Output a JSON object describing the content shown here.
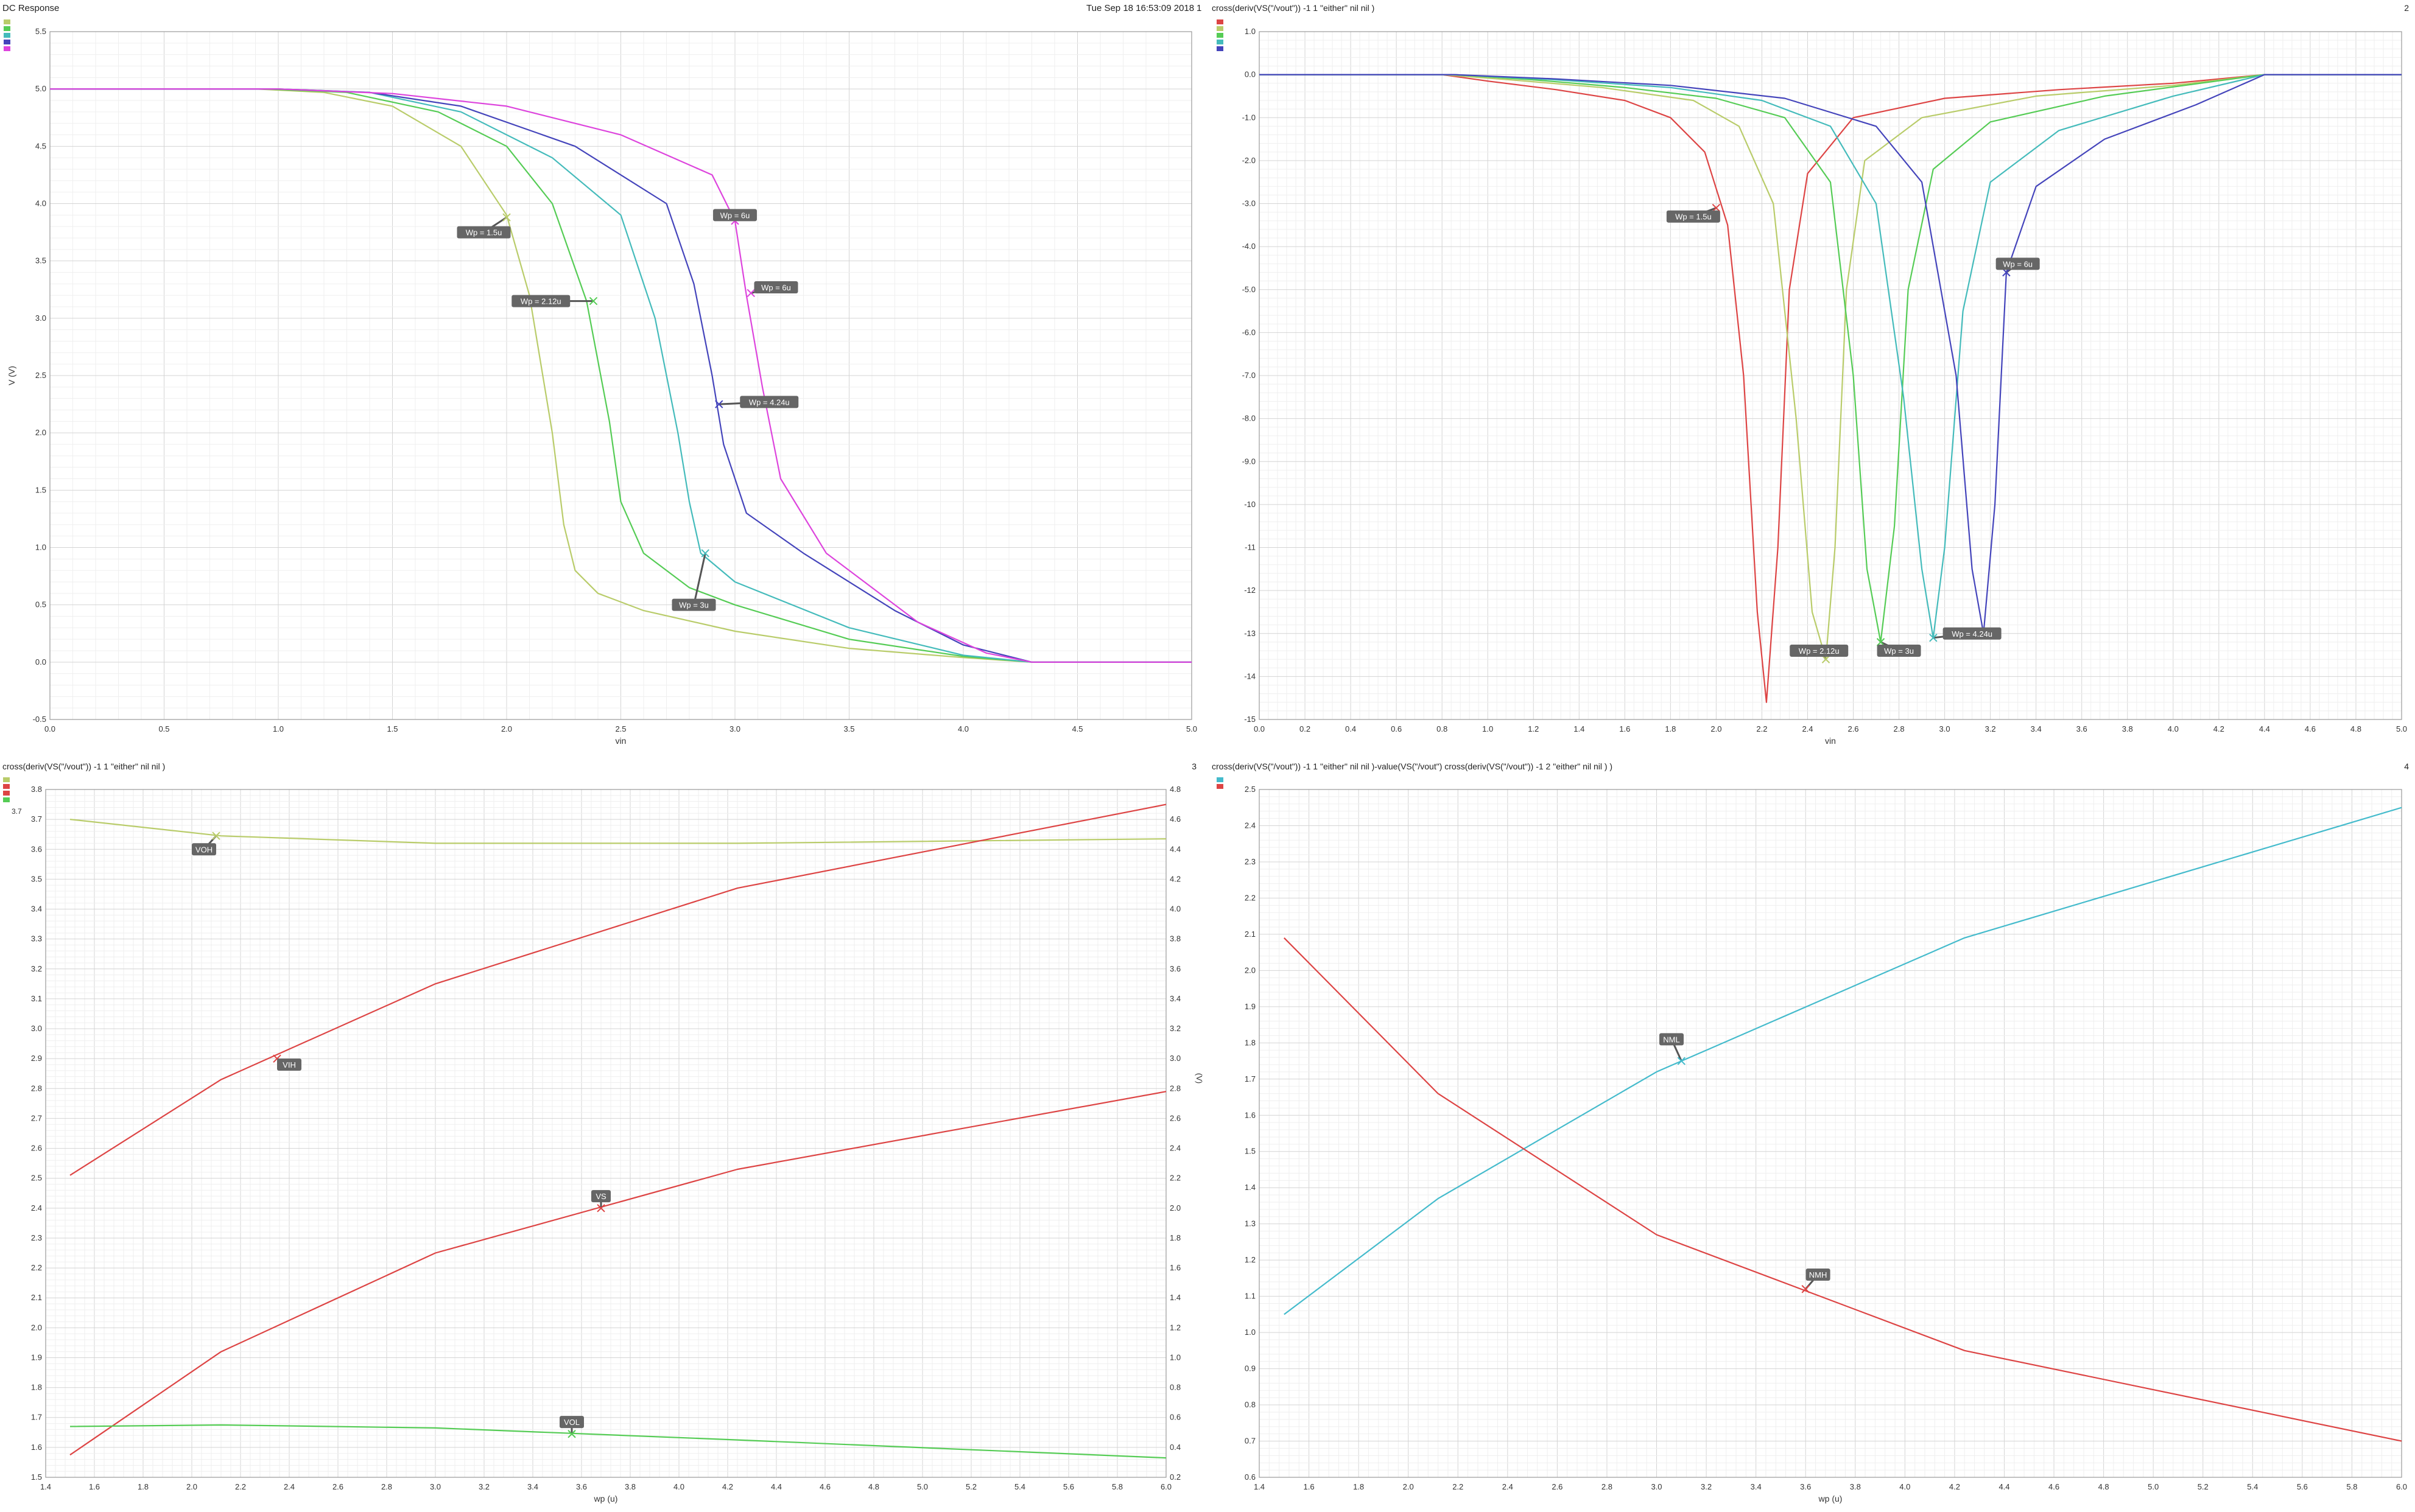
{
  "window": {
    "title": "DC Response",
    "timestamp": "Tue Sep 18 16:53:09 2018",
    "page_number": "1"
  },
  "chart_data": [
    {
      "id": "p1",
      "type": "line",
      "title": "",
      "corner_number": "",
      "xlabel": "vin",
      "ylabel": "V (V)",
      "xlim": [
        0,
        5.0
      ],
      "ylim": [
        -0.5,
        5.5
      ],
      "xticks": [
        "0.0",
        "0.5",
        "1.0",
        "1.5",
        "2.0",
        "2.5",
        "3.0",
        "3.5",
        "4.0",
        "4.5",
        "5.0"
      ],
      "yticks": [
        "-0.5",
        "0.0",
        "0.5",
        "1.0",
        "1.5",
        "2.0",
        "2.5",
        "3.0",
        "3.5",
        "4.0",
        "4.5",
        "5.0",
        "5.5"
      ],
      "grid": true,
      "legend": "top-left",
      "series": [
        {
          "color": "#b9cc6a",
          "x": [
            0,
            0.9,
            1.2,
            1.5,
            1.8,
            2.0,
            2.1,
            2.2,
            2.25,
            2.3,
            2.4,
            2.6,
            3.0,
            3.5,
            4.0,
            4.3,
            5.0
          ],
          "y": [
            5.0,
            5.0,
            4.97,
            4.85,
            4.5,
            3.9,
            3.2,
            2.0,
            1.2,
            0.8,
            0.6,
            0.45,
            0.27,
            0.12,
            0.04,
            0.0,
            0.0
          ]
        },
        {
          "color": "#55cc55",
          "x": [
            0,
            0.95,
            1.3,
            1.7,
            2.0,
            2.2,
            2.35,
            2.45,
            2.5,
            2.6,
            2.8,
            3.0,
            3.5,
            4.0,
            4.3,
            5.0
          ],
          "y": [
            5.0,
            5.0,
            4.97,
            4.8,
            4.5,
            4.0,
            3.15,
            2.1,
            1.4,
            0.95,
            0.65,
            0.5,
            0.2,
            0.05,
            0.0,
            0.0
          ]
        },
        {
          "color": "#44bbbb",
          "x": [
            0,
            1.0,
            1.4,
            1.8,
            2.2,
            2.5,
            2.65,
            2.75,
            2.8,
            2.85,
            3.0,
            3.5,
            4.0,
            4.3,
            5.0
          ],
          "y": [
            5.0,
            5.0,
            4.97,
            4.8,
            4.4,
            3.9,
            3.0,
            2.0,
            1.4,
            0.95,
            0.7,
            0.3,
            0.06,
            0.0,
            0.0
          ]
        },
        {
          "color": "#4444bb",
          "x": [
            0,
            1.0,
            1.4,
            1.8,
            2.3,
            2.7,
            2.82,
            2.9,
            2.95,
            3.05,
            3.3,
            3.7,
            4.0,
            4.3,
            5.0
          ],
          "y": [
            5.0,
            5.0,
            4.97,
            4.85,
            4.5,
            4.0,
            3.3,
            2.5,
            1.9,
            1.3,
            0.95,
            0.45,
            0.15,
            0.0,
            0.0
          ]
        },
        {
          "color": "#dd44dd",
          "x": [
            0,
            1.0,
            1.5,
            2.0,
            2.5,
            2.9,
            3.0,
            3.05,
            3.12,
            3.2,
            3.4,
            3.8,
            4.1,
            4.3,
            5.0
          ],
          "y": [
            5.0,
            5.0,
            4.96,
            4.85,
            4.6,
            4.25,
            3.85,
            3.2,
            2.4,
            1.6,
            0.95,
            0.35,
            0.08,
            0.0,
            0.0
          ]
        }
      ],
      "markers": [
        {
          "label": "Wp = 1.5u",
          "x": 2.0,
          "y": 3.88,
          "color": "#b9cc6a",
          "lx": 1.9,
          "ly": 3.75
        },
        {
          "label": "Wp = 2.12u",
          "x": 2.38,
          "y": 3.15,
          "color": "#55cc55",
          "lx": 2.15,
          "ly": 3.15
        },
        {
          "label": "Wp = 3u",
          "x": 2.87,
          "y": 0.95,
          "color": "#44bbbb",
          "lx": 2.82,
          "ly": 0.5
        },
        {
          "label": "Wp = 4.24u",
          "x": 2.93,
          "y": 2.25,
          "color": "#4444bb",
          "lx": 3.15,
          "ly": 2.27
        },
        {
          "label": "Wp = 6u",
          "x": 3.0,
          "y": 3.85,
          "color": "#dd44dd",
          "lx": 3.0,
          "ly": 3.9
        },
        {
          "label": "Wp = 6u",
          "x": 3.07,
          "y": 3.22,
          "color": "#dd44dd",
          "lx": 3.18,
          "ly": 3.27
        }
      ]
    },
    {
      "id": "p2",
      "type": "line",
      "title": "cross(deriv(VS(\"/vout\")) -1 1 \"either\" nil nil )",
      "corner_number": "2",
      "xlabel": "vin",
      "ylabel": "",
      "xlim": [
        0,
        5.0
      ],
      "ylim": [
        -15.0,
        1.0
      ],
      "xticks": [
        "0.0",
        "0.2",
        "0.4",
        "0.6",
        "0.8",
        "1.0",
        "1.2",
        "1.4",
        "1.6",
        "1.8",
        "2.0",
        "2.2",
        "2.4",
        "2.6",
        "2.8",
        "3.0",
        "3.2",
        "3.4",
        "3.6",
        "3.8",
        "4.0",
        "4.2",
        "4.4",
        "4.6",
        "4.8",
        "5.0"
      ],
      "yticks": [
        "1.0",
        "0.0",
        "-1.0",
        "-2.0",
        "-3.0",
        "-4.0",
        "-5.0",
        "-6.0",
        "-7.0",
        "-8.0",
        "-9.0",
        "-10",
        "-11",
        "-12",
        "-13",
        "-14",
        "-15"
      ],
      "grid": true,
      "legend": "top-left",
      "series": [
        {
          "color": "#dd4444",
          "x": [
            0,
            0.8,
            1.0,
            1.3,
            1.6,
            1.8,
            1.95,
            2.05,
            2.12,
            2.18,
            2.22,
            2.27,
            2.32,
            2.4,
            2.6,
            3.0,
            3.5,
            4.0,
            4.4,
            5.0
          ],
          "y": [
            0,
            0,
            -0.15,
            -0.35,
            -0.6,
            -1.0,
            -1.8,
            -3.5,
            -7.0,
            -12.5,
            -14.6,
            -11.0,
            -5.0,
            -2.3,
            -1.0,
            -0.55,
            -0.35,
            -0.2,
            0,
            0
          ]
        },
        {
          "color": "#b9cc6a",
          "x": [
            0,
            0.8,
            1.1,
            1.5,
            1.9,
            2.1,
            2.25,
            2.35,
            2.42,
            2.48,
            2.52,
            2.57,
            2.65,
            2.9,
            3.4,
            4.0,
            4.4,
            5.0
          ],
          "y": [
            0,
            0,
            -0.12,
            -0.3,
            -0.6,
            -1.2,
            -3.0,
            -8.0,
            -12.5,
            -13.6,
            -11.0,
            -5.0,
            -2.0,
            -1.0,
            -0.5,
            -0.25,
            0,
            0
          ]
        },
        {
          "color": "#55cc55",
          "x": [
            0,
            0.85,
            1.2,
            1.6,
            2.0,
            2.3,
            2.5,
            2.6,
            2.66,
            2.72,
            2.78,
            2.84,
            2.95,
            3.2,
            3.7,
            4.4,
            5.0
          ],
          "y": [
            0,
            0,
            -0.12,
            -0.3,
            -0.55,
            -1.0,
            -2.5,
            -7.0,
            -11.5,
            -13.2,
            -10.5,
            -5.0,
            -2.2,
            -1.1,
            -0.5,
            0,
            0
          ]
        },
        {
          "color": "#44bbbb",
          "x": [
            0,
            0.85,
            1.3,
            1.8,
            2.2,
            2.5,
            2.7,
            2.82,
            2.9,
            2.95,
            3.0,
            3.08,
            3.2,
            3.5,
            4.0,
            4.4,
            5.0
          ],
          "y": [
            0,
            0,
            -0.12,
            -0.3,
            -0.6,
            -1.2,
            -3.0,
            -7.5,
            -11.5,
            -13.1,
            -11.0,
            -5.5,
            -2.5,
            -1.3,
            -0.5,
            0,
            0
          ]
        },
        {
          "color": "#4444bb",
          "x": [
            0,
            0.85,
            1.3,
            1.8,
            2.3,
            2.7,
            2.9,
            3.05,
            3.12,
            3.17,
            3.22,
            3.27,
            3.4,
            3.7,
            4.1,
            4.4,
            5.0
          ],
          "y": [
            0,
            0,
            -0.1,
            -0.25,
            -0.55,
            -1.2,
            -2.5,
            -7.0,
            -11.5,
            -13.0,
            -10.0,
            -4.6,
            -2.6,
            -1.5,
            -0.7,
            0,
            0
          ]
        }
      ],
      "markers": [
        {
          "label": "Wp = 1.5u",
          "x": 2.0,
          "y": -3.1,
          "color": "#dd4444",
          "lx": 1.9,
          "ly": -3.3
        },
        {
          "label": "Wp = 2.12u",
          "x": 2.48,
          "y": -13.6,
          "color": "#b9cc6a",
          "lx": 2.45,
          "ly": -13.4
        },
        {
          "label": "Wp = 3u",
          "x": 2.72,
          "y": -13.2,
          "color": "#55cc55",
          "lx": 2.8,
          "ly": -13.4
        },
        {
          "label": "Wp = 4.24u",
          "x": 2.95,
          "y": -13.1,
          "color": "#44bbbb",
          "lx": 3.12,
          "ly": -13.0
        },
        {
          "label": "Wp = 6u",
          "x": 3.27,
          "y": -4.6,
          "color": "#4444bb",
          "lx": 3.32,
          "ly": -4.4
        }
      ]
    },
    {
      "id": "p3",
      "type": "line",
      "title": "cross(deriv(VS(\"/vout\")) -1 1 \"either\" nil nil )",
      "corner_number": "3",
      "xlabel": "wp (u)",
      "ylabel": "",
      "right_ylabel": "(V)",
      "xlim": [
        1.4,
        6.0
      ],
      "ylim": [
        1.5,
        3.8
      ],
      "right_ylim": [
        0.2,
        4.8
      ],
      "xticks": [
        "1.4",
        "1.6",
        "1.8",
        "2.0",
        "2.2",
        "2.4",
        "2.6",
        "2.8",
        "3.0",
        "3.2",
        "3.4",
        "3.6",
        "3.8",
        "4.0",
        "4.2",
        "4.4",
        "4.6",
        "4.8",
        "5.0",
        "5.2",
        "5.4",
        "5.6",
        "5.8",
        "6.0"
      ],
      "yticks": [
        "1.5",
        "1.6",
        "1.7",
        "1.8",
        "1.9",
        "2.0",
        "2.1",
        "2.2",
        "2.3",
        "2.4",
        "2.5",
        "2.6",
        "2.7",
        "2.8",
        "2.9",
        "3.0",
        "3.1",
        "3.2",
        "3.3",
        "3.4",
        "3.5",
        "3.6",
        "3.7",
        "3.8"
      ],
      "right_yticks": [
        "0.2",
        "0.4",
        "0.6",
        "0.8",
        "1.0",
        "1.2",
        "1.4",
        "1.6",
        "1.8",
        "2.0",
        "2.2",
        "2.4",
        "2.6",
        "2.8",
        "3.0",
        "3.2",
        "3.4",
        "3.6",
        "3.8",
        "4.0",
        "4.2",
        "4.4",
        "4.6",
        "4.8"
      ],
      "grid": true,
      "legend": "top-left",
      "legend_value": "3.7",
      "series": [
        {
          "color": "#b9cc6a",
          "axis": "left",
          "x": [
            1.5,
            2.12,
            3.0,
            4.24,
            6.0
          ],
          "y": [
            3.7,
            3.645,
            3.62,
            3.62,
            3.635
          ]
        },
        {
          "color": "#dd4444",
          "axis": "left",
          "x": [
            1.5,
            2.12,
            3.0,
            4.24,
            6.0
          ],
          "y": [
            2.51,
            2.83,
            3.15,
            3.47,
            3.75
          ]
        },
        {
          "color": "#dd4444",
          "axis": "right",
          "x": [
            1.5,
            2.12,
            3.0,
            4.24,
            6.0
          ],
          "y": [
            0.35,
            1.04,
            1.7,
            2.26,
            2.78
          ]
        },
        {
          "color": "#55cc55",
          "axis": "left",
          "x": [
            1.5,
            2.12,
            3.0,
            4.24,
            6.0
          ],
          "y": [
            1.67,
            1.675,
            1.665,
            1.625,
            1.565
          ]
        }
      ],
      "markers": [
        {
          "label": "VOH",
          "x": 2.1,
          "y": 3.645,
          "axis": "left",
          "color": "#b9cc6a",
          "lx": 2.05,
          "ly": 3.6
        },
        {
          "label": "VIH",
          "x": 2.35,
          "y": 2.9,
          "axis": "left",
          "color": "#dd4444",
          "lx": 2.4,
          "ly": 2.88
        },
        {
          "label": "VS",
          "x": 3.68,
          "y": 2.4,
          "axis": "left",
          "color": "#dd4444",
          "lx": 3.68,
          "ly": 2.44
        },
        {
          "label": "VOL",
          "x": 3.56,
          "y": 1.645,
          "axis": "left",
          "color": "#55cc55",
          "lx": 3.56,
          "ly": 1.685
        }
      ]
    },
    {
      "id": "p4",
      "type": "line",
      "title": "cross(deriv(VS(\"/vout\")) -1 1 \"either\" nil nil )-value(VS(\"/vout\") cross(deriv(VS(\"/vout\")) -1 2 \"either\" nil nil ) )",
      "corner_number": "4",
      "xlabel": "wp (u)",
      "ylabel": "",
      "right_ylabel": "",
      "xlim": [
        1.4,
        6.0
      ],
      "ylim": [
        0.6,
        2.5
      ],
      "xticks": [
        "1.4",
        "1.6",
        "1.8",
        "2.0",
        "2.2",
        "2.4",
        "2.6",
        "2.8",
        "3.0",
        "3.2",
        "3.4",
        "3.6",
        "3.8",
        "4.0",
        "4.2",
        "4.4",
        "4.6",
        "4.8",
        "5.0",
        "5.2",
        "5.4",
        "5.6",
        "5.8",
        "6.0"
      ],
      "yticks": [
        "0.6",
        "0.7",
        "0.8",
        "0.9",
        "1.0",
        "1.1",
        "1.2",
        "1.3",
        "1.4",
        "1.5",
        "1.6",
        "1.7",
        "1.8",
        "1.9",
        "2.0",
        "2.1",
        "2.2",
        "2.3",
        "2.4",
        "2.5"
      ],
      "grid": true,
      "legend": "top-left",
      "series": [
        {
          "color": "#44bbcc",
          "x": [
            1.5,
            2.12,
            3.0,
            4.24,
            6.0
          ],
          "y": [
            1.05,
            1.37,
            1.72,
            2.09,
            2.45
          ]
        },
        {
          "color": "#dd4444",
          "x": [
            1.5,
            2.12,
            3.0,
            4.24,
            6.0
          ],
          "y": [
            2.09,
            1.66,
            1.27,
            0.95,
            0.7
          ]
        }
      ],
      "markers": [
        {
          "label": "NML",
          "x": 3.1,
          "y": 1.75,
          "color": "#44bbcc",
          "lx": 3.06,
          "ly": 1.81
        },
        {
          "label": "NMH",
          "x": 3.6,
          "y": 1.12,
          "color": "#dd4444",
          "lx": 3.65,
          "ly": 1.16
        }
      ]
    }
  ]
}
